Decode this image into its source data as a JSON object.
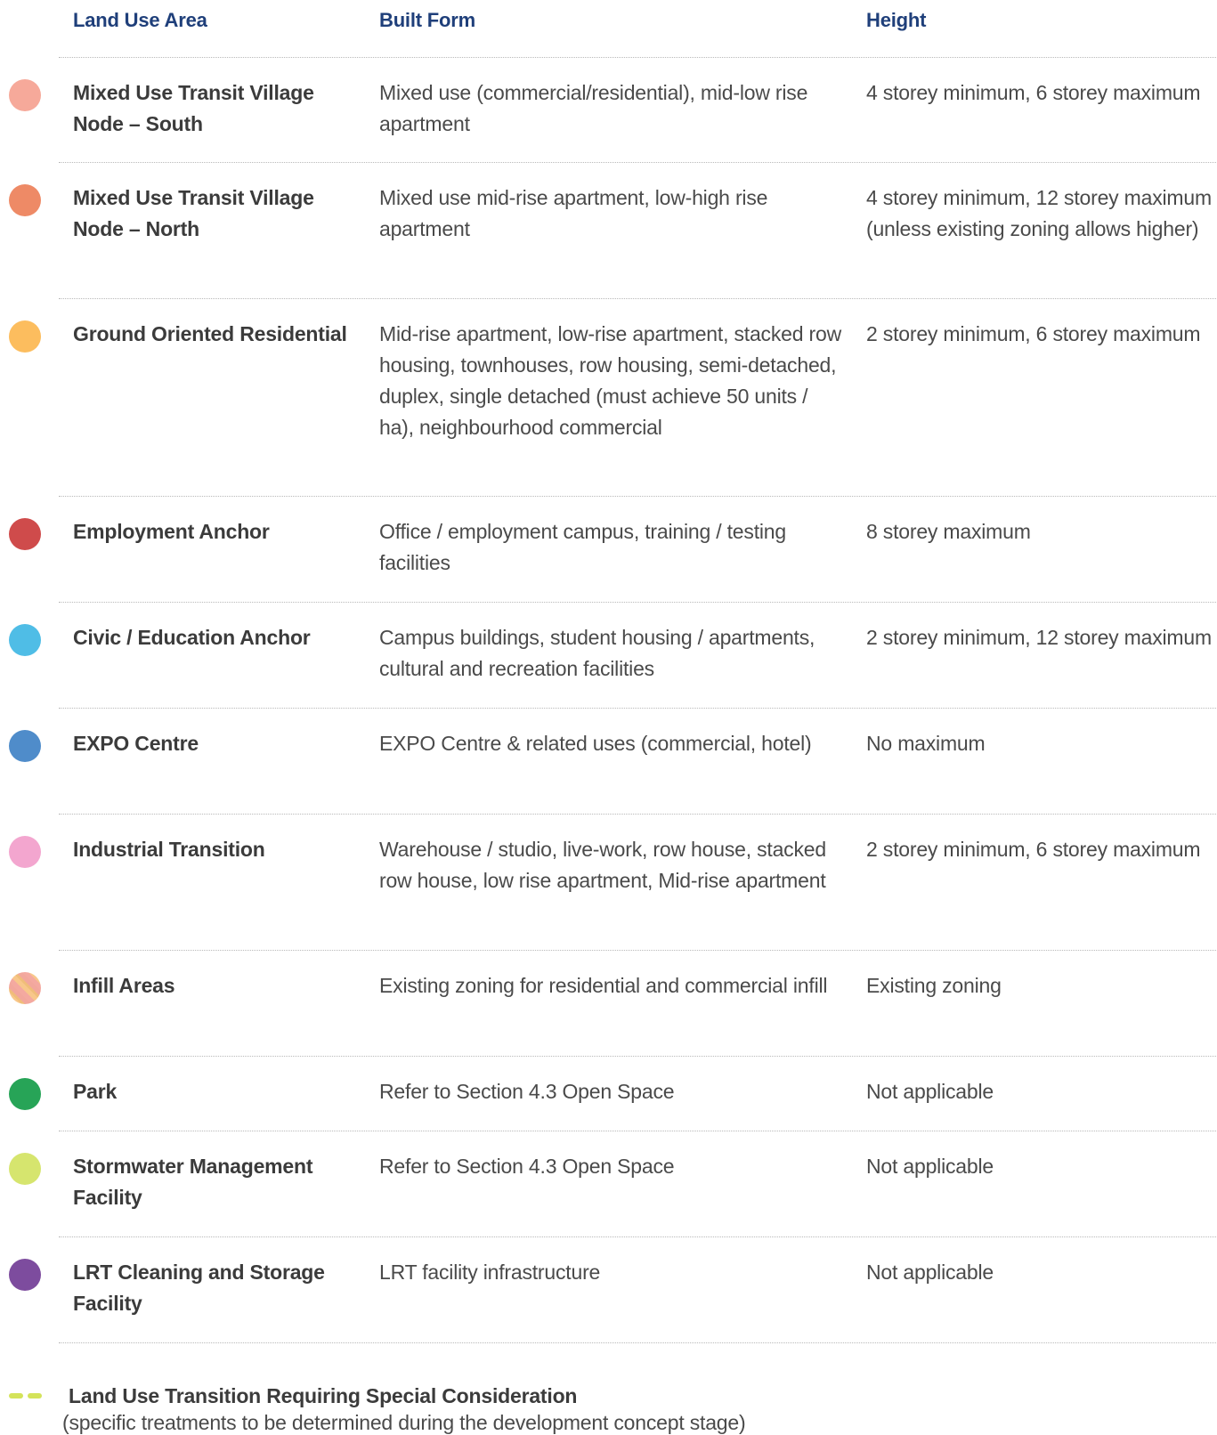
{
  "table": {
    "headers": {
      "land_use_area": "Land Use Area",
      "built_form": "Built Form",
      "height": "Height"
    },
    "rows": [
      {
        "land_use_area": "Mixed Use Transit Village Node – South",
        "built_form": "Mixed use (commercial/residential), mid-low rise apartment",
        "height": "4 storey minimum, 6 storey maximum",
        "color": "#f6a99a"
      },
      {
        "land_use_area": "Mixed Use Transit Village Node – North",
        "built_form": "Mixed use mid-rise apartment, low-high rise apartment",
        "height": "4 storey minimum, 12 storey maximum (unless existing zoning allows higher)",
        "color": "#ee8a66"
      },
      {
        "land_use_area": "Ground Oriented Residential",
        "built_form": "Mid-rise apartment, low-rise apartment, stacked row housing, townhouses, row housing, semi-detached, duplex, single detached (must achieve 50 units / ha), neighbourhood commercial",
        "height": "2 storey minimum, 6 storey maximum",
        "color": "#fcbd5e"
      },
      {
        "land_use_area": "Employment Anchor",
        "built_form": "Office / employment campus, training / testing facilities",
        "height": "8 storey maximum",
        "color": "#cf4b4b"
      },
      {
        "land_use_area": "Civic / Education Anchor",
        "built_form": "Campus buildings, student housing / apartments, cultural and recreation facilities",
        "height": "2 storey minimum, 12 storey maximum",
        "color": "#4fbde6"
      },
      {
        "land_use_area": "EXPO Centre",
        "built_form": "EXPO Centre & related uses (commercial, hotel)",
        "height": "No maximum",
        "color": "#4f8cca"
      },
      {
        "land_use_area": "Industrial Transition",
        "built_form": "Warehouse / studio, live-work, row house, stacked row house, low rise apartment, Mid-rise apartment",
        "height": "2 storey minimum, 6 storey maximum",
        "color": "#f3a6cf"
      },
      {
        "land_use_area": "Infill Areas",
        "built_form": "Existing zoning for residential and commercial infill",
        "height": "Existing zoning",
        "color": "striped"
      },
      {
        "land_use_area": "Park",
        "built_form": "Refer to Section 4.3 Open Space",
        "height": "Not applicable",
        "color": "#27a457"
      },
      {
        "land_use_area": "Stormwater Management Facility",
        "built_form": "Refer to Section 4.3 Open Space",
        "height": "Not applicable",
        "color": "#d6e56e"
      },
      {
        "land_use_area": "LRT Cleaning and Storage Facility",
        "built_form": "LRT facility infrastructure",
        "height": "Not applicable",
        "color": "#7d4c9e"
      }
    ]
  },
  "legend": {
    "title": "Land Use Transition Requiring Special Consideration",
    "note": "(specific treatments to be determined during the development concept stage)",
    "color": "#d4e35a"
  }
}
